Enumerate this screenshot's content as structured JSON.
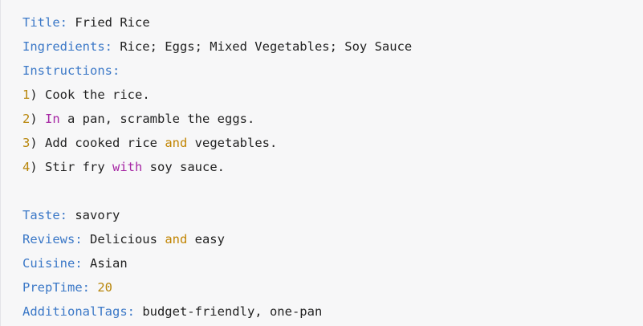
{
  "colors": {
    "background": "#f7f7f8",
    "text": "#222222",
    "key": "#3b78c7",
    "number": "#b8860b",
    "keyword_purple": "#a626a4",
    "keyword_and": "#c18401"
  },
  "recipe": {
    "title": {
      "key": "Title:",
      "value": " Fried Rice"
    },
    "ingredients": {
      "key": "Ingredients:",
      "value": " Rice; Eggs; Mixed Vegetables; Soy Sauce"
    },
    "instructions": {
      "key": "Instructions:",
      "steps": [
        {
          "num": "1",
          "parts": [
            ") Cook the rice."
          ]
        },
        {
          "num": "2",
          "parts": [
            ") ",
            "In",
            " a pan, scramble the eggs."
          ]
        },
        {
          "num": "3",
          "parts": [
            ") Add cooked rice ",
            "and",
            " vegetables."
          ]
        },
        {
          "num": "4",
          "parts": [
            ") Stir fry ",
            "with",
            " soy sauce."
          ]
        }
      ]
    },
    "taste": {
      "key": "Taste:",
      "value": " savory"
    },
    "reviews": {
      "key": "Reviews:",
      "parts": [
        " Delicious ",
        "and",
        " easy"
      ]
    },
    "cuisine": {
      "key": "Cuisine:",
      "value": " Asian"
    },
    "prep_time": {
      "key": "PrepTime:",
      "value": "20"
    },
    "additional_tags": {
      "key": "AdditionalTags:",
      "value": " budget-friendly, one-pan"
    }
  }
}
